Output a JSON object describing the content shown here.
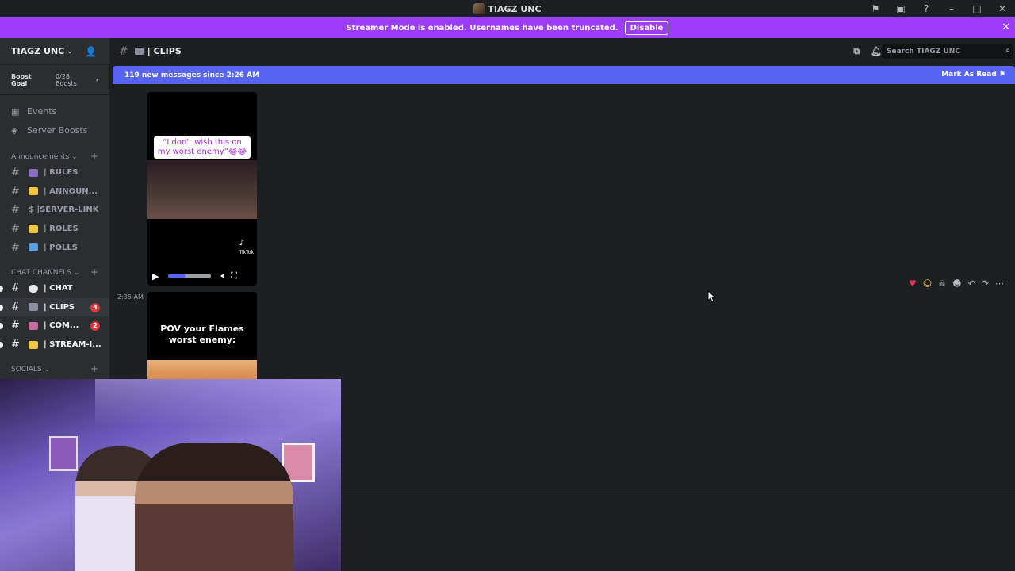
{
  "window": {
    "title": "TIAGZ UNC",
    "icons": [
      "flag-icon",
      "screen-icon",
      "help-icon",
      "minimize-icon",
      "maximize-icon",
      "close-icon"
    ]
  },
  "banner": {
    "text": "Streamer Mode is enabled. Usernames have been truncated.",
    "button": "Disable",
    "close": "✕"
  },
  "sidebar": {
    "server_name": "TIAGZ UNC",
    "boost_goal": "Boost Goal",
    "boost_count": "0/28 Boosts",
    "links": [
      {
        "label": "Events",
        "icon": "calendar-icon"
      },
      {
        "label": "Server Boosts",
        "icon": "boost-icon"
      }
    ],
    "categories": [
      {
        "label": "Announcements",
        "channels": [
          {
            "label": "| RULES",
            "emoji_color": "#8a6cc2"
          },
          {
            "label": "| ANNOUN...",
            "emoji_color": "#f5c542"
          },
          {
            "label": "$ |SERVER-LINK",
            "emoji_color": ""
          },
          {
            "label": "| ROLES",
            "emoji_color": "#f2c744"
          },
          {
            "label": "| POLLS",
            "emoji_color": "#5aa0e0"
          }
        ]
      },
      {
        "label": "CHAT CHANNELS",
        "channels": [
          {
            "label": "| CHAT",
            "emoji_color": "#e8e8e8",
            "badge": ""
          },
          {
            "label": "| CLIPS",
            "emoji_color": "#8a8fa0",
            "badge": "4"
          },
          {
            "label": "| COM...",
            "emoji_color": "#c86aa0",
            "badge": "2"
          },
          {
            "label": "| STREAM-I...",
            "emoji_color": "#f2c744",
            "badge": ""
          }
        ]
      },
      {
        "label": "SOCIALS",
        "channels": []
      }
    ]
  },
  "channel": {
    "name": "| CLIPS",
    "search_placeholder": "Search TIAGZ UNC",
    "new_messages": "119 new messages since 2:26 AM",
    "mark_as_read": "Mark As Read"
  },
  "messages": [
    {
      "caption": "“I don't wish this on my worst enemy”😂😂",
      "watermark": "TikTok"
    },
    {
      "timestamp": "2:35 AM",
      "caption": "POV your Flames worst enemy:"
    }
  ],
  "reactions": [
    "heart-icon",
    "laugh-icon",
    "skull-icon",
    "add-reaction-icon",
    "reply-icon",
    "forward-icon",
    "more-icon"
  ]
}
